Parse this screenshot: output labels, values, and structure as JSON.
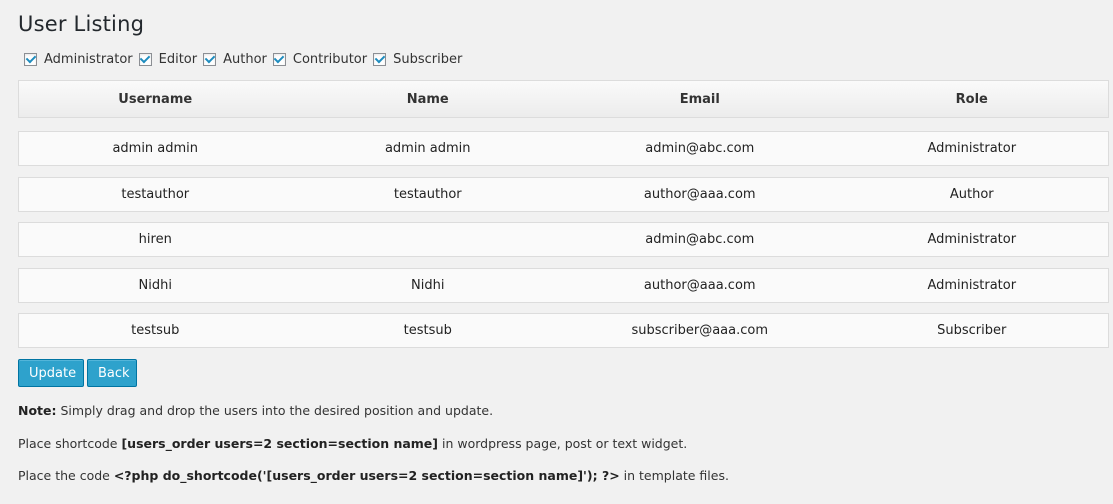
{
  "page": {
    "title": "User Listing"
  },
  "filters": [
    {
      "label": "Administrator",
      "checked": true
    },
    {
      "label": "Editor",
      "checked": true
    },
    {
      "label": "Author",
      "checked": true
    },
    {
      "label": "Contributor",
      "checked": true
    },
    {
      "label": "Subscriber",
      "checked": true
    }
  ],
  "table": {
    "headers": [
      "Username",
      "Name",
      "Email",
      "Role"
    ],
    "rows": [
      [
        "admin admin",
        "admin admin",
        "admin@abc.com",
        "Administrator"
      ],
      [
        "testauthor",
        "testauthor",
        "author@aaa.com",
        "Author"
      ],
      [
        "hiren",
        "",
        "admin@abc.com",
        "Administrator"
      ],
      [
        "Nidhi",
        "Nidhi",
        "author@aaa.com",
        "Administrator"
      ],
      [
        "testsub",
        "testsub",
        "subscriber@aaa.com",
        "Subscriber"
      ]
    ]
  },
  "buttons": {
    "update": "Update",
    "back": "Back"
  },
  "notes": {
    "note_label": "Note:",
    "note_text": " Simply drag and drop the users into the desired position and update.",
    "shortcode_prefix": "Place shortcode ",
    "shortcode_code": "[users_order users=2 section=section name]",
    "shortcode_suffix": " in wordpress page, post or text widget.",
    "php_prefix": "Place the code ",
    "php_code": "<?php do_shortcode('[users_order users=2 section=section name]'); ?>",
    "php_suffix": " in template files."
  },
  "colors": {
    "button_bg": "#2ea2cc",
    "button_border": "#0074a2",
    "page_bg": "#f1f1f1"
  }
}
